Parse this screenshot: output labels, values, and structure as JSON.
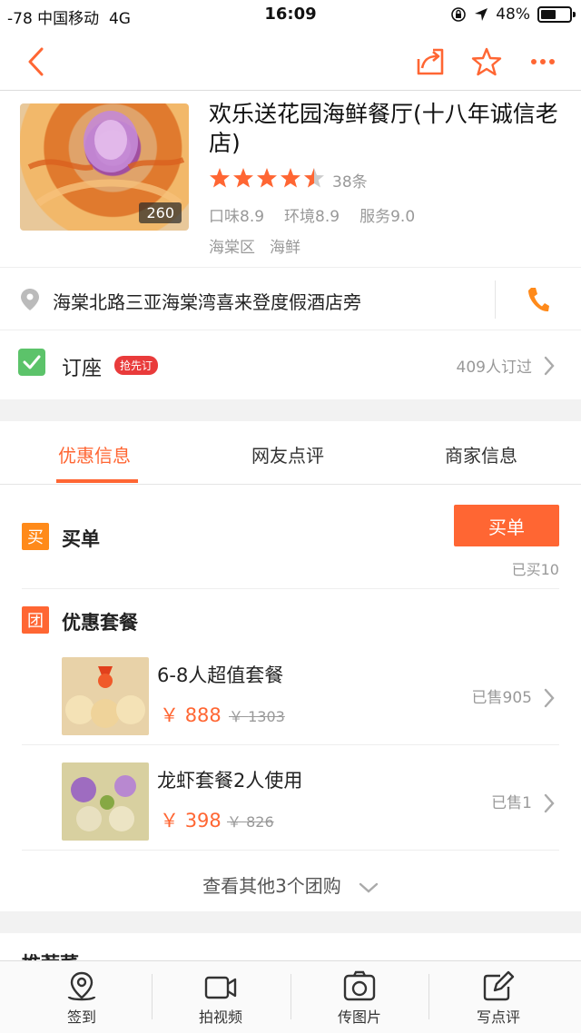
{
  "status_bar": {
    "carrier": "-78 中国移动",
    "network": "4G",
    "time": "16:09",
    "battery": "48%",
    "battery_level": 0.48
  },
  "nav": {
    "back_icon": "chevron-left-icon",
    "share_icon": "share-icon",
    "favorite_icon": "star-outline-icon",
    "more_icon": "more-dots-icon",
    "accent_color": "#ff6633"
  },
  "shop": {
    "name": "欢乐送花园海鲜餐厅(十八年诚信老店)",
    "photo_count": "260",
    "rating_stars": 4.5,
    "review_count": "38条",
    "scores": [
      "口味8.9",
      "环境8.9",
      "服务9.0"
    ],
    "tags": [
      "海棠区",
      "海鲜"
    ],
    "address": "海棠北路三亚海棠湾喜来登度假酒店旁",
    "booking": {
      "label": "订座",
      "badge": "抢先订",
      "count": "409人订过"
    }
  },
  "tabs": [
    {
      "label": "优惠信息",
      "active": true
    },
    {
      "label": "网友点评",
      "active": false
    },
    {
      "label": "商家信息",
      "active": false
    }
  ],
  "offers": {
    "pay": {
      "icon_text": "买",
      "label": "买单",
      "button": "买单",
      "sold": "已买10"
    },
    "packages": {
      "icon_text": "团",
      "title": "优惠套餐",
      "items": [
        {
          "name": "6-8人超值套餐",
          "currency": "￥",
          "price": "888",
          "original_currency": "￥",
          "original": "1303",
          "sold": "已售905"
        },
        {
          "name": "龙虾套餐2人使用",
          "currency": "￥",
          "price": "398",
          "original_currency": "￥",
          "original": "826",
          "sold": "已售1"
        }
      ],
      "more": "查看其他3个团购"
    }
  },
  "recommend": {
    "title": "推荐菜"
  },
  "bottom_bar": [
    {
      "label": "签到",
      "icon": "location-pin-icon"
    },
    {
      "label": "拍视频",
      "icon": "video-camera-icon"
    },
    {
      "label": "传图片",
      "icon": "photo-upload-icon"
    },
    {
      "label": "写点评",
      "icon": "write-review-icon"
    }
  ]
}
